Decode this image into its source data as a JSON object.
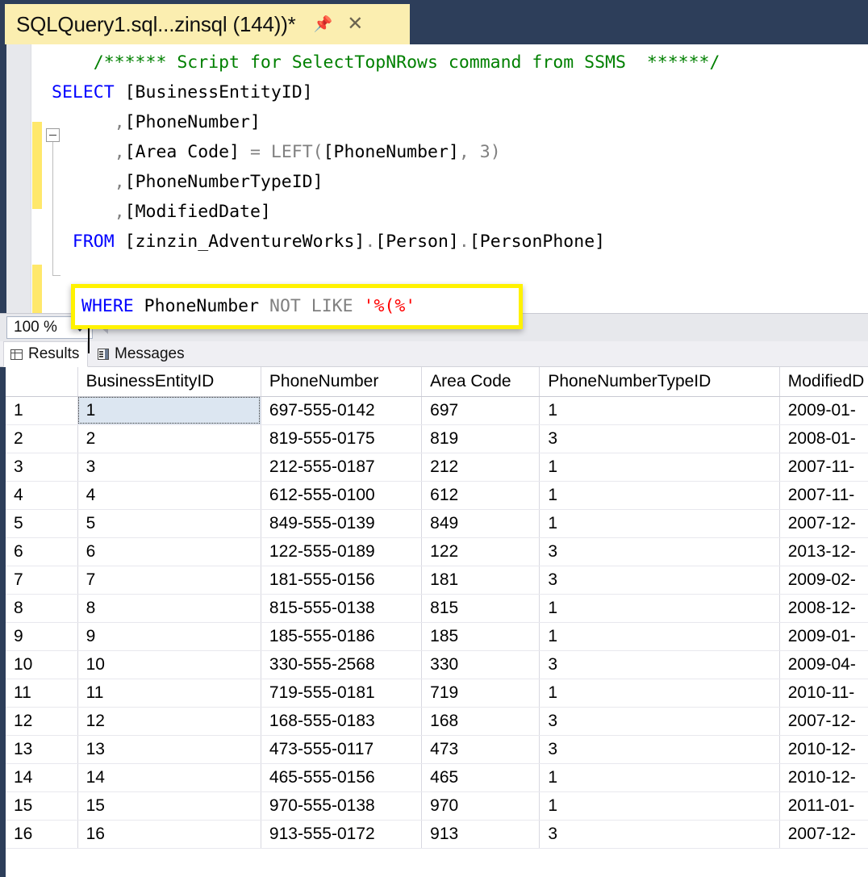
{
  "window": {
    "tab": {
      "title": "SQLQuery1.sql...zinsql (144))*",
      "pin_icon": "pin-icon",
      "close_icon": "close-icon"
    }
  },
  "editor": {
    "lines": [
      {
        "id": "comment",
        "segments": [
          {
            "text": "    ",
            "style": "plain"
          },
          {
            "text": "/****** Script for SelectTopNRows command from SSMS  ******/",
            "style": "cmt"
          }
        ]
      },
      {
        "id": "select",
        "segments": [
          {
            "text": "SELECT",
            "style": "kw"
          },
          {
            "text": " [BusinessEntityID]",
            "style": "plain"
          }
        ]
      },
      {
        "id": "col-phonenumber",
        "segments": [
          {
            "text": "      ",
            "style": "plain"
          },
          {
            "text": ",",
            "style": "punc"
          },
          {
            "text": "[PhoneNumber]",
            "style": "plain"
          }
        ]
      },
      {
        "id": "col-areacode",
        "segments": [
          {
            "text": "      ",
            "style": "plain"
          },
          {
            "text": ",",
            "style": "punc"
          },
          {
            "text": "[Area Code] ",
            "style": "plain"
          },
          {
            "text": "=",
            "style": "gray"
          },
          {
            "text": " ",
            "style": "plain"
          },
          {
            "text": "LEFT(",
            "style": "gray"
          },
          {
            "text": "[PhoneNumber]",
            "style": "plain"
          },
          {
            "text": ",",
            "style": "gray"
          },
          {
            "text": " ",
            "style": "plain"
          },
          {
            "text": "3)",
            "style": "gray"
          }
        ]
      },
      {
        "id": "col-phonenumbertypeid",
        "segments": [
          {
            "text": "      ",
            "style": "plain"
          },
          {
            "text": ",",
            "style": "punc"
          },
          {
            "text": "[PhoneNumberTypeID]",
            "style": "plain"
          }
        ]
      },
      {
        "id": "col-modifieddate",
        "segments": [
          {
            "text": "      ",
            "style": "plain"
          },
          {
            "text": ",",
            "style": "punc"
          },
          {
            "text": "[ModifiedDate]",
            "style": "plain"
          }
        ]
      },
      {
        "id": "from",
        "segments": [
          {
            "text": "  ",
            "style": "plain"
          },
          {
            "text": "FROM",
            "style": "kw"
          },
          {
            "text": " [zinzin_AdventureWorks]",
            "style": "plain"
          },
          {
            "text": ".",
            "style": "punc"
          },
          {
            "text": "[Person]",
            "style": "plain"
          },
          {
            "text": ".",
            "style": "punc"
          },
          {
            "text": "[PersonPhone]",
            "style": "plain"
          }
        ]
      }
    ],
    "where_callout": {
      "segments": [
        {
          "text": "WHERE",
          "style": "kw"
        },
        {
          "text": " PhoneNumber ",
          "style": "plain"
        },
        {
          "text": "NOT LIKE",
          "style": "gray"
        },
        {
          "text": " ",
          "style": "plain"
        },
        {
          "text": "'%(%'",
          "style": "str"
        }
      ],
      "highlight_color": "#FFF200"
    }
  },
  "zoom_strip": {
    "zoom_value": "100 %",
    "dropdown_icon": "chevron-down-icon",
    "scroll_left_icon": "scroll-left-arrow-icon"
  },
  "result_tabs": [
    {
      "id": "results",
      "label": "Results",
      "icon": "grid-icon",
      "active": true
    },
    {
      "id": "messages",
      "label": "Messages",
      "icon": "message-icon",
      "active": false
    }
  ],
  "results_grid": {
    "columns": [
      "",
      "BusinessEntityID",
      "PhoneNumber",
      "Area Code",
      "PhoneNumberTypeID",
      "ModifiedD"
    ],
    "rows": [
      {
        "n": "1",
        "BusinessEntityID": "1",
        "PhoneNumber": "697-555-0142",
        "AreaCode": "697",
        "PhoneNumberTypeID": "1",
        "ModifiedDate": "2009-01-"
      },
      {
        "n": "2",
        "BusinessEntityID": "2",
        "PhoneNumber": "819-555-0175",
        "AreaCode": "819",
        "PhoneNumberTypeID": "3",
        "ModifiedDate": "2008-01-"
      },
      {
        "n": "3",
        "BusinessEntityID": "3",
        "PhoneNumber": "212-555-0187",
        "AreaCode": "212",
        "PhoneNumberTypeID": "1",
        "ModifiedDate": "2007-11-"
      },
      {
        "n": "4",
        "BusinessEntityID": "4",
        "PhoneNumber": "612-555-0100",
        "AreaCode": "612",
        "PhoneNumberTypeID": "1",
        "ModifiedDate": "2007-11-"
      },
      {
        "n": "5",
        "BusinessEntityID": "5",
        "PhoneNumber": "849-555-0139",
        "AreaCode": "849",
        "PhoneNumberTypeID": "1",
        "ModifiedDate": "2007-12-"
      },
      {
        "n": "6",
        "BusinessEntityID": "6",
        "PhoneNumber": "122-555-0189",
        "AreaCode": "122",
        "PhoneNumberTypeID": "3",
        "ModifiedDate": "2013-12-"
      },
      {
        "n": "7",
        "BusinessEntityID": "7",
        "PhoneNumber": "181-555-0156",
        "AreaCode": "181",
        "PhoneNumberTypeID": "3",
        "ModifiedDate": "2009-02-"
      },
      {
        "n": "8",
        "BusinessEntityID": "8",
        "PhoneNumber": "815-555-0138",
        "AreaCode": "815",
        "PhoneNumberTypeID": "1",
        "ModifiedDate": "2008-12-"
      },
      {
        "n": "9",
        "BusinessEntityID": "9",
        "PhoneNumber": "185-555-0186",
        "AreaCode": "185",
        "PhoneNumberTypeID": "1",
        "ModifiedDate": "2009-01-"
      },
      {
        "n": "10",
        "BusinessEntityID": "10",
        "PhoneNumber": "330-555-2568",
        "AreaCode": "330",
        "PhoneNumberTypeID": "3",
        "ModifiedDate": "2009-04-"
      },
      {
        "n": "11",
        "BusinessEntityID": "11",
        "PhoneNumber": "719-555-0181",
        "AreaCode": "719",
        "PhoneNumberTypeID": "1",
        "ModifiedDate": "2010-11-"
      },
      {
        "n": "12",
        "BusinessEntityID": "12",
        "PhoneNumber": "168-555-0183",
        "AreaCode": "168",
        "PhoneNumberTypeID": "3",
        "ModifiedDate": "2007-12-"
      },
      {
        "n": "13",
        "BusinessEntityID": "13",
        "PhoneNumber": "473-555-0117",
        "AreaCode": "473",
        "PhoneNumberTypeID": "3",
        "ModifiedDate": "2010-12-"
      },
      {
        "n": "14",
        "BusinessEntityID": "14",
        "PhoneNumber": "465-555-0156",
        "AreaCode": "465",
        "PhoneNumberTypeID": "1",
        "ModifiedDate": "2010-12-"
      },
      {
        "n": "15",
        "BusinessEntityID": "15",
        "PhoneNumber": "970-555-0138",
        "AreaCode": "970",
        "PhoneNumberTypeID": "1",
        "ModifiedDate": "2011-01-"
      },
      {
        "n": "16",
        "BusinessEntityID": "16",
        "PhoneNumber": "913-555-0172",
        "AreaCode": "913",
        "PhoneNumberTypeID": "3",
        "ModifiedDate": "2007-12-"
      }
    ],
    "selected_cell": {
      "row": 0,
      "column": "BusinessEntityID"
    }
  },
  "colors": {
    "tab_active_bg": "#FBEEB0",
    "window_chrome": "#2D3E5A",
    "keyword": "#0000FF",
    "comment": "#008000",
    "string": "#FF0000",
    "function_gray": "#808080",
    "change_bar": "#FFE86B",
    "callout_highlight": "#FFF200",
    "selected_cell_bg": "#DCE6F1"
  }
}
